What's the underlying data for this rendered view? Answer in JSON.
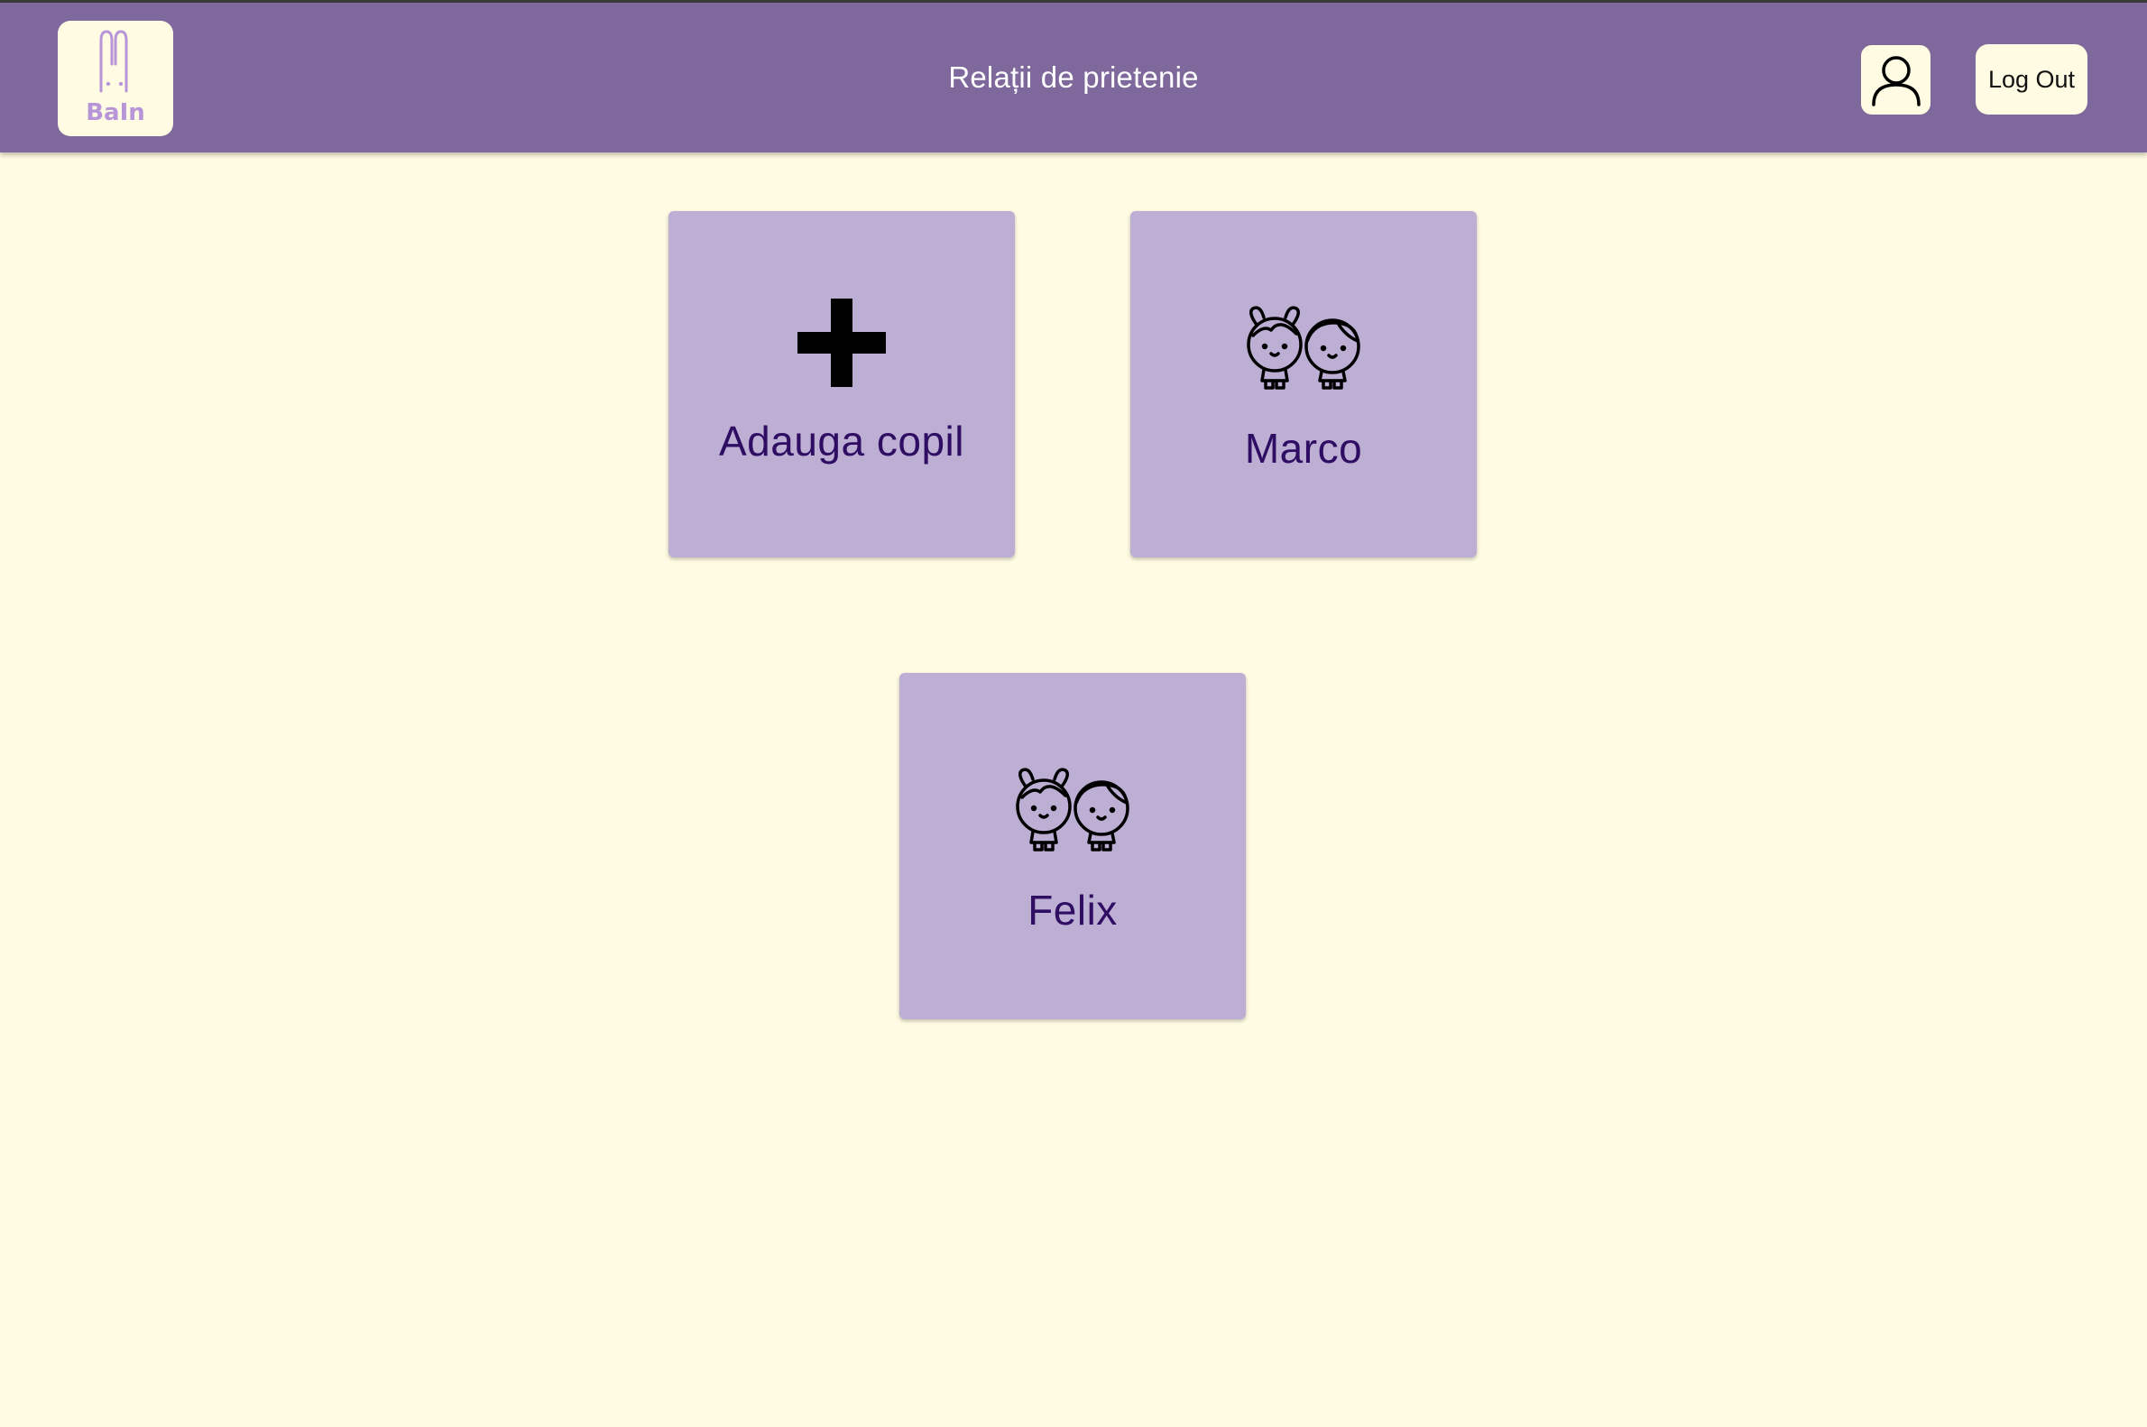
{
  "header": {
    "logo_text": "BaIn",
    "title": "Relații de prietenie",
    "logout_label": "Log Out",
    "profile_icon": "user-profile-icon",
    "background_color": "#7e689c"
  },
  "cards": [
    {
      "label": "Adauga copil",
      "icon": "plus-icon"
    },
    {
      "label": "Marco",
      "icon": "children-icon"
    },
    {
      "label": "Felix",
      "icon": "children-icon"
    }
  ],
  "colors": {
    "page_background": "#fffce3",
    "card_background": "#bdaed4",
    "card_text": "#2e0d63",
    "logo_accent": "#b795d8"
  }
}
